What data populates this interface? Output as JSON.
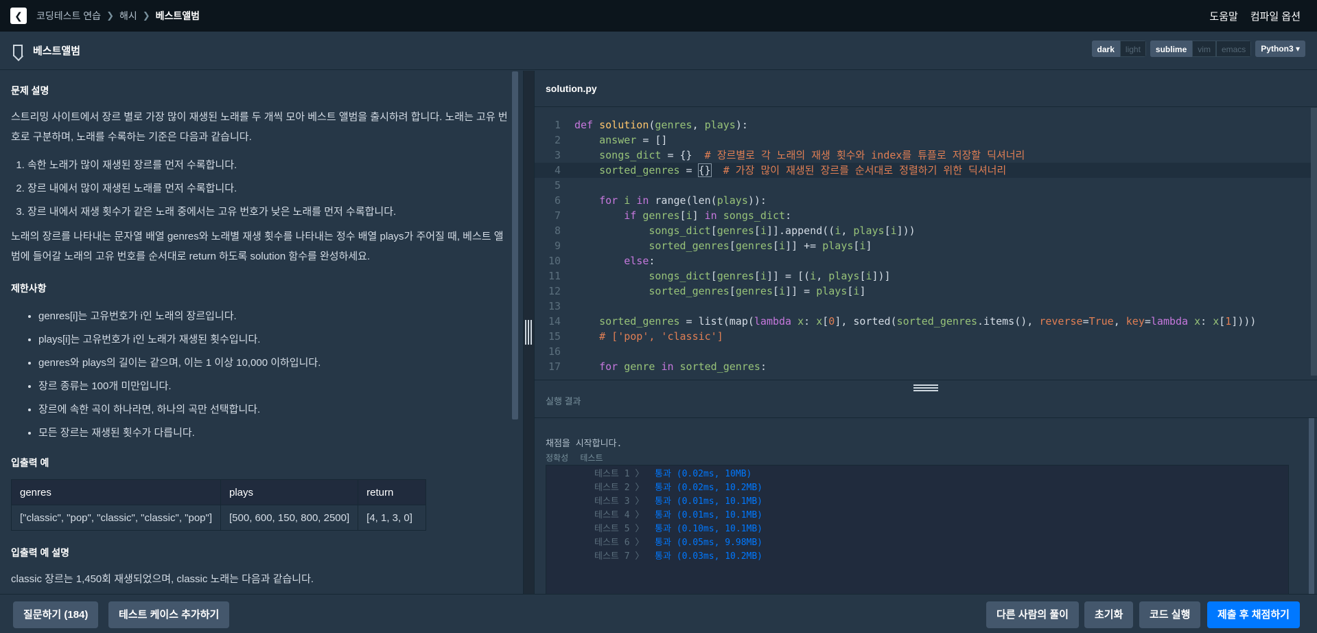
{
  "header": {
    "breadcrumbs": [
      "코딩테스트 연습",
      "해시",
      "베스트앨범"
    ],
    "links": [
      "도움말",
      "컴파일 옵션"
    ]
  },
  "subheader": {
    "title": "베스트앨범",
    "theme": [
      "dark",
      "light"
    ],
    "keymap": [
      "sublime",
      "vim",
      "emacs"
    ],
    "language": "Python3"
  },
  "problem": {
    "desc_heading": "문제 설명",
    "desc_p1": "스트리밍 사이트에서 장르 별로 가장 많이 재생된 노래를 두 개씩 모아 베스트 앨범을 출시하려 합니다. 노래는 고유 번호로 구분하며, 노래를 수록하는 기준은 다음과 같습니다.",
    "rules": [
      "속한 노래가 많이 재생된 장르를 먼저 수록합니다.",
      "장르 내에서 많이 재생된 노래를 먼저 수록합니다.",
      "장르 내에서 재생 횟수가 같은 노래 중에서는 고유 번호가 낮은 노래를 먼저 수록합니다."
    ],
    "desc_p2": "노래의 장르를 나타내는 문자열 배열 genres와 노래별 재생 횟수를 나타내는 정수 배열 plays가 주어질 때, 베스트 앨범에 들어갈 노래의 고유 번호를 순서대로 return 하도록 solution 함수를 완성하세요.",
    "limits_heading": "제한사항",
    "limits": [
      "genres[i]는 고유번호가 i인 노래의 장르입니다.",
      "plays[i]는 고유번호가 i인 노래가 재생된 횟수입니다.",
      "genres와 plays의 길이는 같으며, 이는 1 이상 10,000 이하입니다.",
      "장르 종류는 100개 미만입니다.",
      "장르에 속한 곡이 하나라면, 하나의 곡만 선택합니다.",
      "모든 장르는 재생된 횟수가 다릅니다."
    ],
    "io_heading": "입출력 예",
    "io_table": {
      "headers": [
        "genres",
        "plays",
        "return"
      ],
      "row": [
        "[\"classic\", \"pop\", \"classic\", \"classic\", \"pop\"]",
        "[500, 600, 150, 800, 2500]",
        "[4, 1, 3, 0]"
      ]
    },
    "io_desc_heading": "입출력 예 설명",
    "io_desc_p": "classic 장르는 1,450회 재생되었으며, classic 노래는 다음과 같습니다."
  },
  "editor": {
    "filename": "solution.py",
    "line_numbers": [
      "1",
      "2",
      "3",
      "4",
      "5",
      "6",
      "7",
      "8",
      "9",
      "10",
      "11",
      "12",
      "13",
      "14",
      "15",
      "16",
      "17"
    ]
  },
  "results": {
    "label": "실행 결과",
    "start": "채점을 시작합니다.",
    "tabs": [
      "정확성",
      "테스트"
    ],
    "rows": [
      {
        "name": "테스트 1 〉",
        "res": "통과 (0.02ms, 10MB)"
      },
      {
        "name": "테스트 2 〉",
        "res": "통과 (0.02ms, 10.2MB)"
      },
      {
        "name": "테스트 3 〉",
        "res": "통과 (0.01ms, 10.1MB)"
      },
      {
        "name": "테스트 4 〉",
        "res": "통과 (0.01ms, 10.1MB)"
      },
      {
        "name": "테스트 5 〉",
        "res": "통과 (0.10ms, 10.1MB)"
      },
      {
        "name": "테스트 6 〉",
        "res": "통과 (0.05ms, 9.98MB)"
      },
      {
        "name": "테스트 7 〉",
        "res": "통과 (0.03ms, 10.2MB)"
      }
    ]
  },
  "footer": {
    "ask": "질문하기 (184)",
    "add_case": "테스트 케이스 추가하기",
    "others": "다른 사람의 풀이",
    "reset": "초기화",
    "run": "코드 실행",
    "submit": "제출 후 채점하기"
  },
  "colors": {
    "background": "#263747",
    "topbar": "#0c151c",
    "primary": "#0078ff",
    "button": "#44576c"
  }
}
